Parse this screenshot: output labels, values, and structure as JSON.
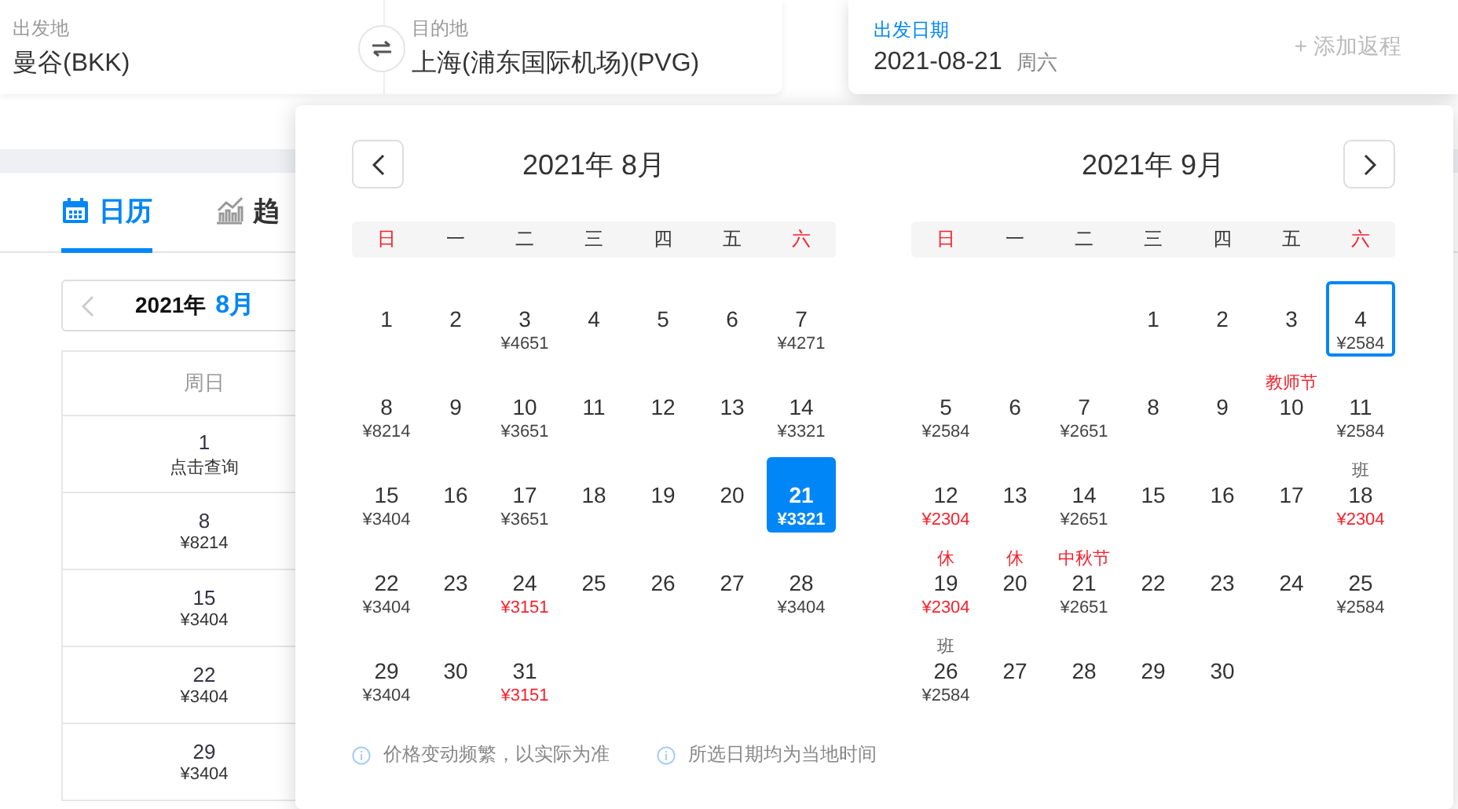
{
  "search": {
    "origin": {
      "label": "出发地",
      "value": "曼谷(BKK)"
    },
    "destination": {
      "label": "目的地",
      "value": "上海(浦东国际机场)(PVG)"
    },
    "date": {
      "label": "出发日期",
      "value": "2021-08-21",
      "weekday": "周六",
      "return_placeholder": "+ 添加返程"
    }
  },
  "tabs": [
    {
      "label": "日历",
      "selected": true
    },
    {
      "label": "趋",
      "selected": false
    }
  ],
  "calendar_nav": {
    "year": "2021年",
    "month": "8月"
  },
  "calendar_table": {
    "columns": [
      "周日"
    ],
    "rows": [
      {
        "day": "1",
        "price": "点击查询"
      },
      {
        "day": "8",
        "price": "¥8214"
      },
      {
        "day": "15",
        "price": "¥3404"
      },
      {
        "day": "22",
        "price": "¥3404"
      },
      {
        "day": "29",
        "price": "¥3404"
      }
    ]
  },
  "popup": {
    "months": [
      {
        "title": "2021年 8月",
        "prev_button": true,
        "next_button": false,
        "weekdays": [
          {
            "label": "日",
            "weekend": true
          },
          {
            "label": "一",
            "weekend": false
          },
          {
            "label": "二",
            "weekend": false
          },
          {
            "label": "三",
            "weekend": false
          },
          {
            "label": "四",
            "weekend": false
          },
          {
            "label": "五",
            "weekend": false
          },
          {
            "label": "六",
            "weekend": true
          }
        ],
        "days": [
          {
            "kind": "day",
            "day": "1",
            "selected": false,
            "focused": false
          },
          {
            "kind": "day",
            "day": "2",
            "selected": false,
            "focused": false
          },
          {
            "kind": "day",
            "day": "3",
            "price": "¥4651",
            "price_low": false,
            "selected": false,
            "focused": false
          },
          {
            "kind": "day",
            "day": "4",
            "selected": false,
            "focused": false
          },
          {
            "kind": "day",
            "day": "5",
            "selected": false,
            "focused": false
          },
          {
            "kind": "day",
            "day": "6",
            "selected": false,
            "focused": false
          },
          {
            "kind": "day",
            "day": "7",
            "price": "¥4271",
            "price_low": false,
            "selected": false,
            "focused": false
          },
          {
            "kind": "day",
            "day": "8",
            "price": "¥8214",
            "price_low": false,
            "selected": false,
            "focused": false
          },
          {
            "kind": "day",
            "day": "9",
            "selected": false,
            "focused": false
          },
          {
            "kind": "day",
            "day": "10",
            "price": "¥3651",
            "price_low": false,
            "selected": false,
            "focused": false
          },
          {
            "kind": "day",
            "day": "11",
            "selected": false,
            "focused": false
          },
          {
            "kind": "day",
            "day": "12",
            "selected": false,
            "focused": false
          },
          {
            "kind": "day",
            "day": "13",
            "selected": false,
            "focused": false
          },
          {
            "kind": "day",
            "day": "14",
            "price": "¥3321",
            "price_low": false,
            "selected": false,
            "focused": false
          },
          {
            "kind": "day",
            "day": "15",
            "price": "¥3404",
            "price_low": false,
            "selected": false,
            "focused": false
          },
          {
            "kind": "day",
            "day": "16",
            "selected": false,
            "focused": false
          },
          {
            "kind": "day",
            "day": "17",
            "price": "¥3651",
            "price_low": false,
            "selected": false,
            "focused": false
          },
          {
            "kind": "day",
            "day": "18",
            "selected": false,
            "focused": false
          },
          {
            "kind": "day",
            "day": "19",
            "selected": false,
            "focused": false
          },
          {
            "kind": "day",
            "day": "20",
            "selected": false,
            "focused": false
          },
          {
            "kind": "day",
            "day": "21",
            "price": "¥3321",
            "price_low": false,
            "selected": true,
            "focused": false
          },
          {
            "kind": "day",
            "day": "22",
            "price": "¥3404",
            "price_low": false,
            "selected": false,
            "focused": false
          },
          {
            "kind": "day",
            "day": "23",
            "selected": false,
            "focused": false
          },
          {
            "kind": "day",
            "day": "24",
            "price": "¥3151",
            "price_low": true,
            "selected": false,
            "focused": false
          },
          {
            "kind": "day",
            "day": "25",
            "selected": false,
            "focused": false
          },
          {
            "kind": "day",
            "day": "26",
            "selected": false,
            "focused": false
          },
          {
            "kind": "day",
            "day": "27",
            "selected": false,
            "focused": false
          },
          {
            "kind": "day",
            "day": "28",
            "price": "¥3404",
            "price_low": false,
            "selected": false,
            "focused": false
          },
          {
            "kind": "day",
            "day": "29",
            "price": "¥3404",
            "price_low": false,
            "selected": false,
            "focused": false
          },
          {
            "kind": "day",
            "day": "30",
            "selected": false,
            "focused": false
          },
          {
            "kind": "day",
            "day": "31",
            "price": "¥3151",
            "price_low": true,
            "selected": false,
            "focused": false
          }
        ]
      },
      {
        "title": "2021年 9月",
        "prev_button": false,
        "next_button": true,
        "weekdays": [
          {
            "label": "日",
            "weekend": true
          },
          {
            "label": "一",
            "weekend": false
          },
          {
            "label": "二",
            "weekend": false
          },
          {
            "label": "三",
            "weekend": false
          },
          {
            "label": "四",
            "weekend": false
          },
          {
            "label": "五",
            "weekend": false
          },
          {
            "label": "六",
            "weekend": true
          }
        ],
        "days": [
          {
            "kind": "blank"
          },
          {
            "kind": "blank"
          },
          {
            "kind": "blank"
          },
          {
            "kind": "day",
            "day": "1",
            "selected": false,
            "focused": false
          },
          {
            "kind": "day",
            "day": "2",
            "selected": false,
            "focused": false
          },
          {
            "kind": "day",
            "day": "3",
            "selected": false,
            "focused": false
          },
          {
            "kind": "day",
            "day": "4",
            "price": "¥2584",
            "price_low": false,
            "selected": false,
            "focused": true
          },
          {
            "kind": "day",
            "day": "5",
            "price": "¥2584",
            "price_low": false,
            "selected": false,
            "focused": false
          },
          {
            "kind": "day",
            "day": "6",
            "selected": false,
            "focused": false
          },
          {
            "kind": "day",
            "day": "7",
            "price": "¥2651",
            "price_low": false,
            "selected": false,
            "focused": false
          },
          {
            "kind": "day",
            "day": "8",
            "selected": false,
            "focused": false
          },
          {
            "kind": "day",
            "day": "9",
            "selected": false,
            "focused": false
          },
          {
            "kind": "day",
            "day": "10",
            "tag": "教师节",
            "tag_red": true,
            "selected": false,
            "focused": false
          },
          {
            "kind": "day",
            "day": "11",
            "price": "¥2584",
            "price_low": false,
            "selected": false,
            "focused": false
          },
          {
            "kind": "day",
            "day": "12",
            "price": "¥2304",
            "price_low": true,
            "selected": false,
            "focused": false
          },
          {
            "kind": "day",
            "day": "13",
            "selected": false,
            "focused": false
          },
          {
            "kind": "day",
            "day": "14",
            "price": "¥2651",
            "price_low": false,
            "selected": false,
            "focused": false
          },
          {
            "kind": "day",
            "day": "15",
            "selected": false,
            "focused": false
          },
          {
            "kind": "day",
            "day": "16",
            "selected": false,
            "focused": false
          },
          {
            "kind": "day",
            "day": "17",
            "selected": false,
            "focused": false
          },
          {
            "kind": "day",
            "day": "18",
            "tag": "班",
            "tag_red": false,
            "price": "¥2304",
            "price_low": true,
            "selected": false,
            "focused": false
          },
          {
            "kind": "day",
            "day": "19",
            "tag": "休",
            "tag_red": true,
            "price": "¥2304",
            "price_low": true,
            "selected": false,
            "focused": false
          },
          {
            "kind": "day",
            "day": "20",
            "tag": "休",
            "tag_red": true,
            "selected": false,
            "focused": false
          },
          {
            "kind": "day",
            "day": "21",
            "tag": "中秋节",
            "tag_red": true,
            "price": "¥2651",
            "price_low": false,
            "selected": false,
            "focused": false
          },
          {
            "kind": "day",
            "day": "22",
            "selected": false,
            "focused": false
          },
          {
            "kind": "day",
            "day": "23",
            "selected": false,
            "focused": false
          },
          {
            "kind": "day",
            "day": "24",
            "selected": false,
            "focused": false
          },
          {
            "kind": "day",
            "day": "25",
            "price": "¥2584",
            "price_low": false,
            "selected": false,
            "focused": false
          },
          {
            "kind": "day",
            "day": "26",
            "tag": "班",
            "tag_red": false,
            "price": "¥2584",
            "price_low": false,
            "selected": false,
            "focused": false
          },
          {
            "kind": "day",
            "day": "27",
            "selected": false,
            "focused": false
          },
          {
            "kind": "day",
            "day": "28",
            "selected": false,
            "focused": false
          },
          {
            "kind": "day",
            "day": "29",
            "selected": false,
            "focused": false
          },
          {
            "kind": "day",
            "day": "30",
            "selected": false,
            "focused": false
          }
        ]
      }
    ],
    "notes": [
      "价格变动频繁，以实际为准",
      "所选日期均为当地时间"
    ]
  }
}
